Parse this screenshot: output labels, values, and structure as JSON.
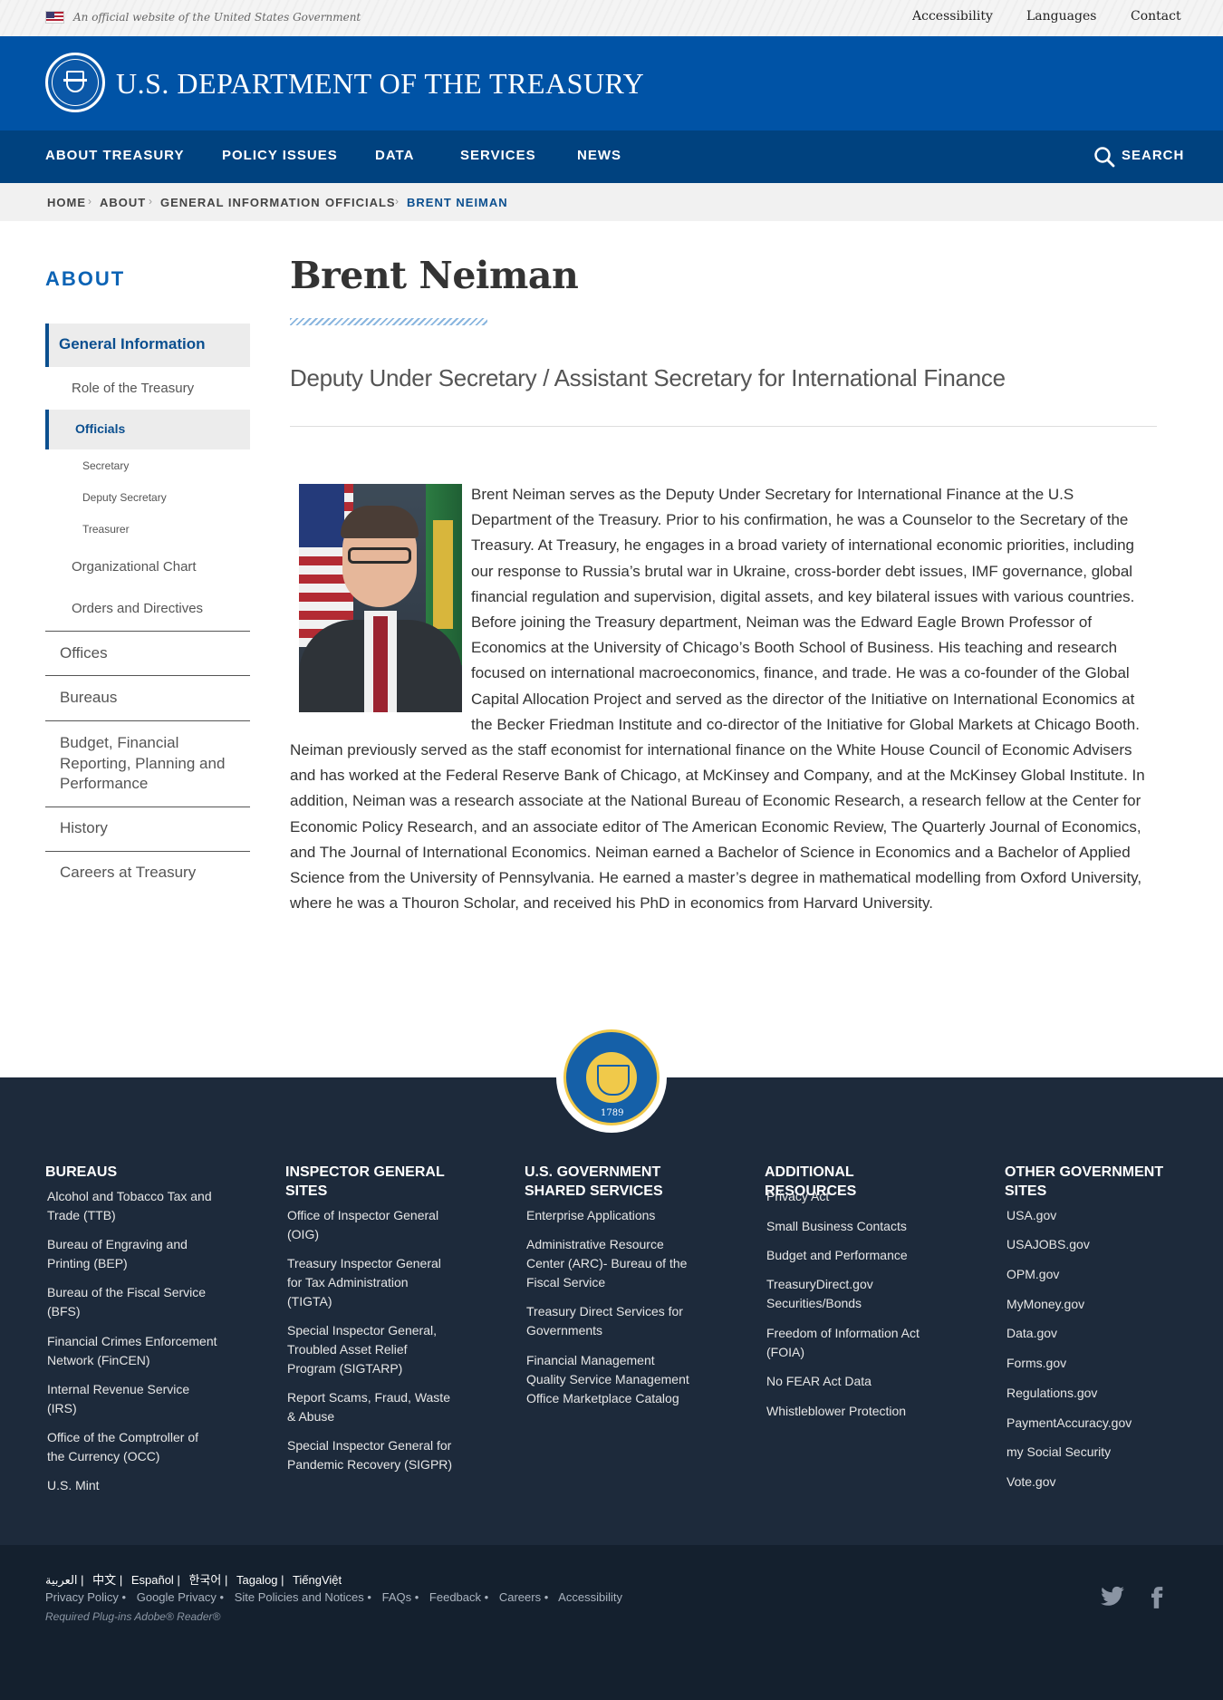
{
  "gov_banner": {
    "text": "An official website of the United States Government",
    "links": [
      "Accessibility",
      "Languages",
      "Contact"
    ]
  },
  "header": {
    "title": "U.S. DEPARTMENT OF THE TREASURY"
  },
  "nav": {
    "items": [
      "ABOUT TREASURY",
      "POLICY ISSUES",
      "DATA",
      "SERVICES",
      "NEWS"
    ],
    "search_label": "SEARCH"
  },
  "breadcrumb": [
    "HOME",
    "ABOUT",
    "GENERAL INFORMATION",
    "OFFICIALS",
    "BRENT NEIMAN"
  ],
  "sidebar": {
    "heading": "ABOUT",
    "general_information": "General Information",
    "role": "Role of the Treasury",
    "officials": "Officials",
    "officials_sub": [
      "Secretary",
      "Deputy Secretary",
      "Treasurer"
    ],
    "org_chart": "Organizational Chart",
    "orders": "Orders and Directives",
    "top_items": [
      "Offices",
      "Bureaus",
      "Budget, Financial Reporting, Planning and Performance",
      "History",
      "Careers at Treasury"
    ]
  },
  "main": {
    "title": "Brent Neiman",
    "subtitle": "Deputy Under Secretary / Assistant Secretary for International Finance",
    "bio": "Brent Neiman serves as the Deputy Under Secretary for International Finance at the U.S Department of the Treasury. Prior to his confirmation, he was a Counselor to the Secretary of the Treasury. At Treasury, he engages in a broad variety of international economic priorities, including our response to Russia’s brutal war in Ukraine, cross-border debt issues, IMF governance, global financial regulation and supervision, digital assets, and key bilateral issues with various countries. Before joining the Treasury department, Neiman was the Edward Eagle Brown Professor of Economics at the University of Chicago’s Booth School of Business. His teaching and research focused on international macroeconomics, finance, and trade. He was a co-founder of the Global Capital Allocation Project and served as the director of the Initiative on International Economics at the Becker Friedman Institute and co-director of the Initiative for Global Markets at Chicago Booth. Neiman previously served as the staff economist for international finance on the White House Council of Economic Advisers and has worked at the Federal Reserve Bank of Chicago, at McKinsey and Company, and at the McKinsey Global Institute. In addition, Neiman was a research associate at the National Bureau of Economic Research, a research fellow at the Center for Economic Policy Research, and an associate editor of The American Economic Review, The Quarterly Journal of Economics, and The Journal of International Economics. Neiman earned a Bachelor of Science in Economics and a Bachelor of Applied Science from the University of Pennsylvania. He earned a master’s degree in mathematical modelling from Oxford University, where he was a Thouron Scholar, and received his PhD in economics from Harvard University."
  },
  "footer": {
    "seal_year": "1789",
    "columns": [
      {
        "title": "BUREAUS",
        "links": [
          "Alcohol and Tobacco Tax and Trade (TTB)",
          "Bureau of Engraving and Printing (BEP)",
          "Bureau of the Fiscal Service (BFS)",
          "Financial Crimes Enforcement Network (FinCEN)",
          "Internal Revenue Service (IRS)",
          "Office of the Comptroller of the Currency (OCC)",
          "U.S. Mint"
        ]
      },
      {
        "title": "INSPECTOR GENERAL SITES",
        "links": [
          "Office of Inspector General (OIG)",
          "Treasury Inspector General for Tax Administration (TIGTA)",
          "Special Inspector General, Troubled Asset Relief Program (SIGTARP)",
          "Report Scams, Fraud, Waste & Abuse",
          "Special Inspector General for Pandemic Recovery (SIGPR)"
        ]
      },
      {
        "title": "U.S. GOVERNMENT SHARED SERVICES",
        "links": [
          "Enterprise Applications",
          "Administrative Resource Center (ARC)- Bureau of the Fiscal Service",
          "Treasury Direct Services for Governments",
          "Financial Management Quality Service Management Office Marketplace Catalog"
        ]
      },
      {
        "title": "ADDITIONAL RESOURCES",
        "links": [
          "Privacy Act",
          "Small Business Contacts",
          "Budget and Performance",
          "TreasuryDirect.gov Securities/Bonds",
          "Freedom of Information Act (FOIA)",
          "No FEAR Act Data",
          "Whistleblower Protection"
        ]
      },
      {
        "title": "OTHER GOVERNMENT SITES",
        "links": [
          "USA.gov",
          "USAJOBS.gov",
          "OPM.gov",
          "MyMoney.gov",
          "Data.gov",
          "Forms.gov",
          "Regulations.gov",
          "PaymentAccuracy.gov",
          "my Social Security",
          "Vote.gov"
        ]
      }
    ],
    "languages": [
      "العربية",
      "|",
      "中文",
      "|",
      "Español",
      "|",
      "한국어",
      "|",
      "Tagalog",
      "|",
      "TiếngViệt"
    ],
    "legal_links": [
      "Privacy Policy",
      "•",
      "Google Privacy",
      "•",
      "Site Policies and Notices",
      "•",
      "FAQs",
      "•",
      "Feedback",
      "•",
      "Careers",
      "•",
      "Accessibility"
    ],
    "plugins": "Required Plug-ins   Adobe® Reader®",
    "social": {
      "twitter": "twitter-icon",
      "facebook": "facebook-icon"
    }
  }
}
